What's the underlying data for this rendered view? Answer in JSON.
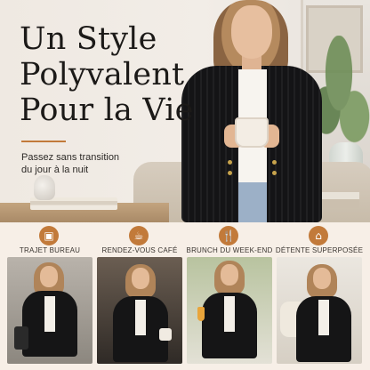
{
  "hero": {
    "title_lines": [
      "Un Style",
      "Polyvalent",
      "Pour la Vie"
    ],
    "subtitle_lines": [
      "Passez sans transition",
      "du jour à la nuit"
    ]
  },
  "occasions": [
    {
      "label": "TRAJET BUREAU",
      "icon": "briefcase-icon",
      "glyph": "▣"
    },
    {
      "label": "RENDEZ-VOUS CAFÉ",
      "icon": "coffee-cup-icon",
      "glyph": "☕"
    },
    {
      "label": "BRUNCH DU WEEK-END",
      "icon": "utensils-icon",
      "glyph": "🍴"
    },
    {
      "label": "DÉTENTE SUPERPOSÉE",
      "icon": "house-icon",
      "glyph": "⌂"
    }
  ],
  "colors": {
    "accent": "#c27a3a",
    "background": "#f7efe7",
    "cardigan": "#141416",
    "headline_text": "#1c1a18"
  }
}
